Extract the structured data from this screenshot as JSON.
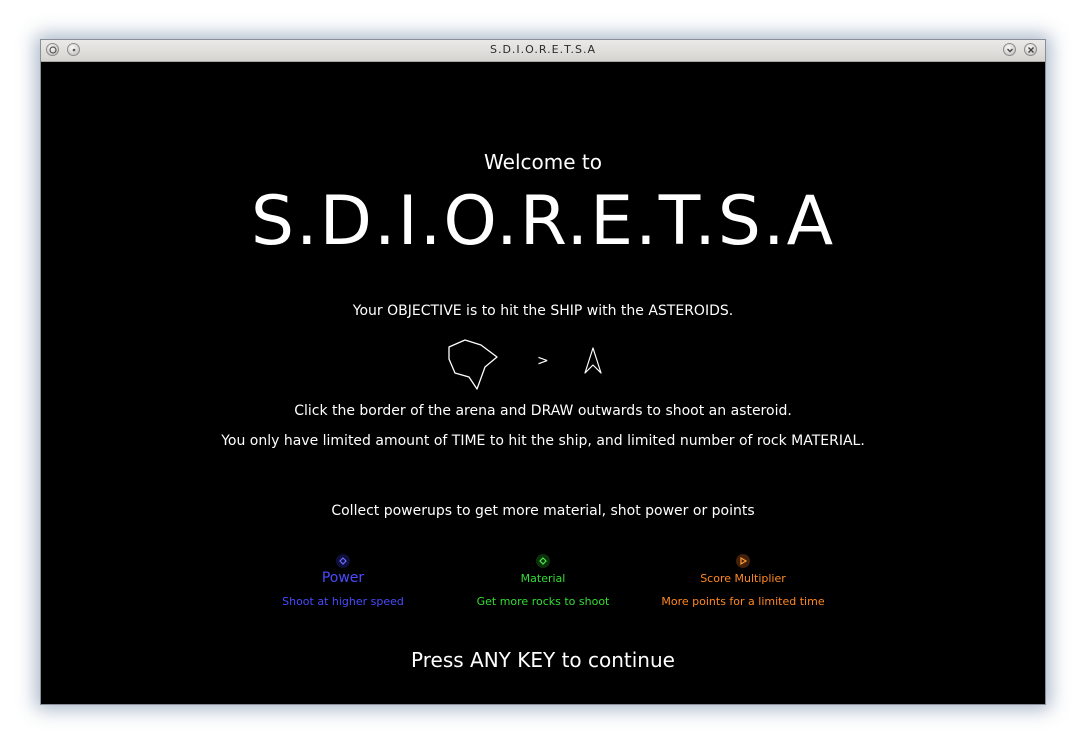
{
  "window": {
    "title": "S.D.I.O.R.E.T.S.A"
  },
  "screen": {
    "welcome": "Welcome to",
    "game_title": "S.D.I.O.R.E.T.S.A",
    "objective": "Your OBJECTIVE is to hit the SHIP with the ASTEROIDS.",
    "arrow": ">",
    "instruction_draw": "Click the border of the arena and DRAW outwards to shoot an asteroid.",
    "instruction_limits": "You only have limited amount of TIME to hit the ship, and limited number of rock MATERIAL.",
    "collect": "Collect powerups to get more material, shot power or points",
    "continue": "Press ANY KEY to continue"
  },
  "powerups": [
    {
      "name": "Power",
      "description": "Shoot at higher speed",
      "color": "#4444ff",
      "icon": "diamond-icon"
    },
    {
      "name": "Material",
      "description": "Get more rocks to shoot",
      "color": "#33dd33",
      "icon": "diamond-icon"
    },
    {
      "name": "Score Multiplier",
      "description": "More points for a limited time",
      "color": "#ff8822",
      "icon": "triangle-icon"
    }
  ],
  "colors": {
    "background": "#000000",
    "text": "#ffffff"
  }
}
